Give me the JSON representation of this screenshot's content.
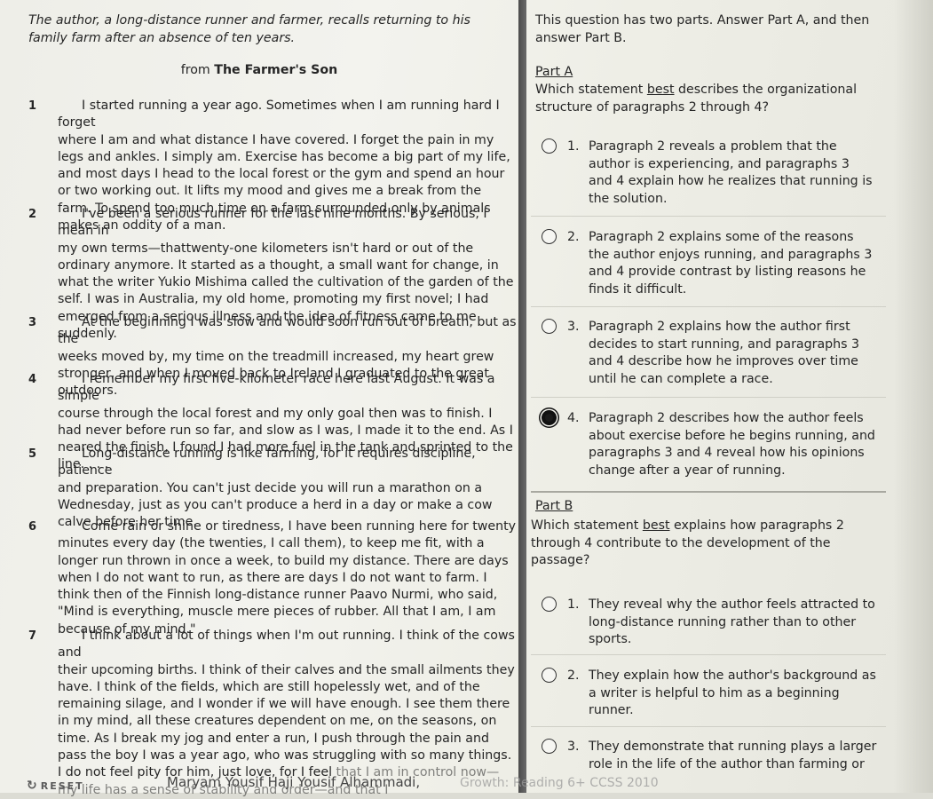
{
  "passage": {
    "intro": "The author, a long-distance runner and farmer, recalls returning to his family farm after an absence of ten years.",
    "source_prefix": "from",
    "source_title": "The Farmer's Son",
    "paragraphs": [
      {
        "num": "1",
        "first": "I started running a year ago. Sometimes when I am running hard I forget",
        "rest": "where I am and what distance I have covered. I forget the pain in my legs and ankles. I simply am. Exercise has become a big part of my life, and most days I head to the local forest or the gym and spend an hour or two working out. It lifts my mood and gives me a break from the farm. To spend too much time on a farm surrounded only by animals makes an oddity of a man."
      },
      {
        "num": "2",
        "first": "I've been a serious runner for the last nine months. By serious, I mean in",
        "rest": "my own terms—thattwenty-one kilometers isn't hard or out of the ordinary anymore. It started as a thought, a small want for change, in what the writer Yukio Mishima called the cultivation of the garden of the self. I was in Australia, my old home, promoting my first novel; I had emerged from a serious illness and the idea of fitness came to me suddenly."
      },
      {
        "num": "3",
        "first": "At the beginning I was slow and would soon run out of breath, but as the",
        "rest": "weeks moved by, my time on the treadmill increased, my heart grew stronger, and when I moved back to Ireland I graduated to the great outdoors."
      },
      {
        "num": "4",
        "first": "I remember my first five-kilometer race here last August. It was a simple",
        "rest": "course through the local forest and my only goal then was to finish. I had never before run so far, and slow as I was, I made it to the end. As I neared the finish, I found I had more fuel in the tank and sprinted to the line. . . ."
      },
      {
        "num": "5",
        "first": "Long-distance running is like farming, for it requires discipline, patience",
        "rest": "and preparation. You can't just decide you will run a marathon on a Wednesday, just as you can't produce a herd in a day or make a cow calve before her time."
      },
      {
        "num": "6",
        "first": "Come rain or shine or tiredness, I have been running here for twenty",
        "rest": "minutes every day (the twenties, I call them), to keep me fit, with a longer run thrown in once a week, to build my distance. There are days when I do not want to run, as there are days I do not want to farm. I think then of the Finnish long-distance runner Paavo Nurmi, who said, \"Mind is everything, muscle mere pieces of rubber. All that I am, I am because of my mind.\""
      },
      {
        "num": "7",
        "first": "I think about a lot of things when I'm out running. I think of the cows and",
        "rest": "their upcoming births. I think of their calves and the small ailments they have. I think of the fields, which are still hopelessly wet, and of the remaining silage, and I wonder if we will have enough. I see them there in my mind, all these creatures dependent on me, on the seasons, on time. As I break my jog and enter a run, I push through the pain and pass the boy I was a year ago, who was struggling with so many things. I do not feel pity for him, just love, for I feel",
        "faded": "that I am in control now—my life has a sense of stability and order—and that I"
      }
    ]
  },
  "question": {
    "header": "This question has two parts. Answer Part A, and then answer Part B.",
    "part_a": {
      "label": "Part A",
      "prompt_pre": "Which statement ",
      "prompt_em": "best",
      "prompt_post": " describes the organizational structure of paragraphs 2 through 4?",
      "options": [
        {
          "num": "1.",
          "text": "Paragraph 2 reveals a problem that the author is experiencing, and paragraphs 3 and 4 explain how he realizes that running is the solution.",
          "selected": false
        },
        {
          "num": "2.",
          "text": "Paragraph 2 explains some of the reasons the author enjoys running, and paragraphs 3 and 4 provide contrast by listing reasons he finds it difficult.",
          "selected": false
        },
        {
          "num": "3.",
          "text": "Paragraph 2 explains how the author first decides to start running, and paragraphs 3 and 4 describe how he improves over time until he can complete a race.",
          "selected": false
        },
        {
          "num": "4.",
          "text": "Paragraph 2 describes how the author feels about exercise before he begins running, and paragraphs 3 and 4 reveal how his opinions change after a year of running.",
          "selected": true
        }
      ]
    },
    "part_b": {
      "label": "Part B",
      "prompt_pre": "Which statement ",
      "prompt_em": "best",
      "prompt_post": " explains how paragraphs 2 through 4 contribute to the development of the passage?",
      "options": [
        {
          "num": "1.",
          "text": "They reveal why the author feels attracted to long-distance running rather than to other sports.",
          "selected": false
        },
        {
          "num": "2.",
          "text": "They explain how the author's background as a writer is helpful to him as a beginning runner.",
          "selected": false
        },
        {
          "num": "3.",
          "text": "They demonstrate that running plays a larger role in the life of the author than farming or",
          "selected": false
        }
      ]
    }
  },
  "footer": {
    "reset_label": "RESET",
    "reset_icon": "rotate-icon",
    "student_name": "Maryam Yousif Haji Yousif Alhammadi,",
    "note": "Growth: Reading 6+ CCSS 2010"
  }
}
